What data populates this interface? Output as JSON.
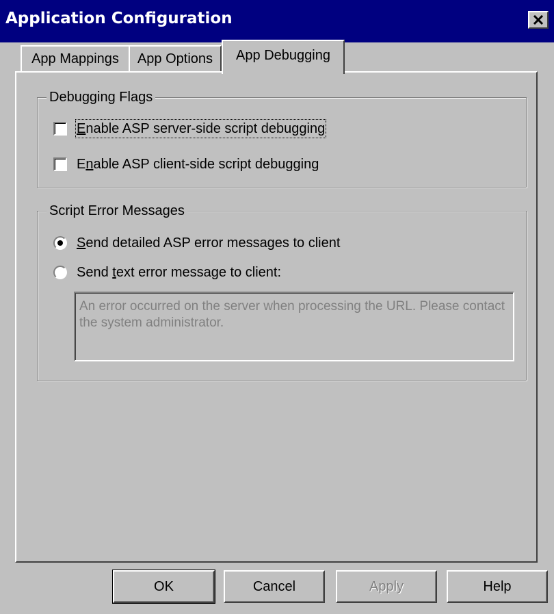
{
  "window": {
    "title": "Application Configuration"
  },
  "tabs": [
    {
      "label": "App Mappings",
      "selected": false
    },
    {
      "label": "App Options",
      "selected": false
    },
    {
      "label": "App Debugging",
      "selected": true
    }
  ],
  "debugging_flags": {
    "title": "Debugging Flags",
    "server_side": {
      "label": "Enable ASP server-side script debugging",
      "checked": false
    },
    "client_side": {
      "label": "Enable ASP client-side script debugging",
      "checked": false
    }
  },
  "script_errors": {
    "title": "Script Error Messages",
    "detailed": {
      "label": "Send detailed ASP error messages to client",
      "selected": true
    },
    "text": {
      "label": "Send text error message to client:",
      "selected": false
    },
    "message": "An error occurred on the server when processing the URL.  Please contact the system administrator."
  },
  "buttons": {
    "ok": "OK",
    "cancel": "Cancel",
    "apply": "Apply",
    "help": "Help"
  },
  "colors": {
    "titlebar": "#000080",
    "face": "#c0c0c0",
    "disabled_text": "#808080"
  },
  "icons": {
    "close": "close-icon"
  }
}
